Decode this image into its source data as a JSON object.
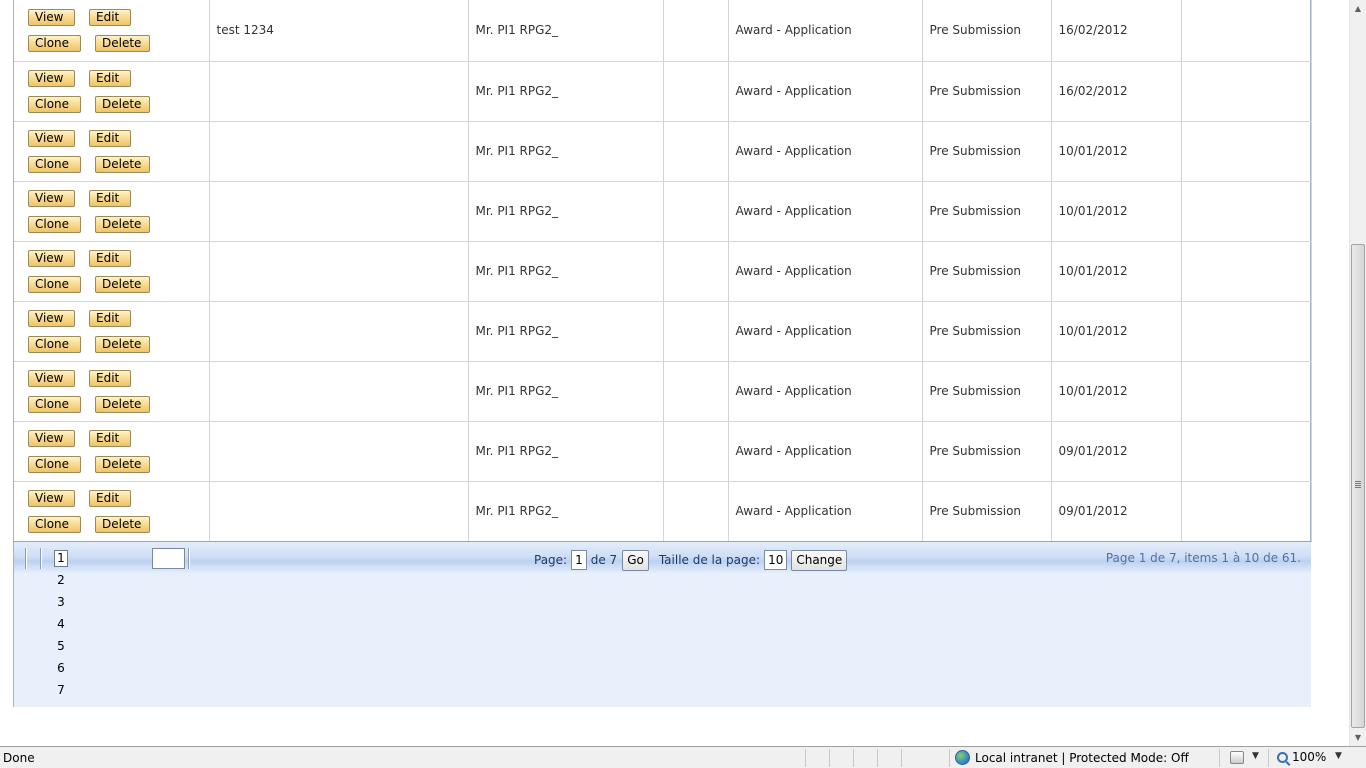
{
  "buttons": {
    "view": "View",
    "edit": "Edit",
    "clone": "Clone",
    "delete": "Delete"
  },
  "rows": [
    {
      "title": "test 1234",
      "pi": "Mr. PI1 RPG2_",
      "col3": "",
      "type": "Award - Application",
      "status": "Pre Submission",
      "date": "16/02/2012",
      "col7": ""
    },
    {
      "title": "",
      "pi": "Mr. PI1 RPG2_",
      "col3": "",
      "type": "Award - Application",
      "status": "Pre Submission",
      "date": "16/02/2012",
      "col7": ""
    },
    {
      "title": "",
      "pi": "Mr. PI1 RPG2_",
      "col3": "",
      "type": "Award - Application",
      "status": "Pre Submission",
      "date": "10/01/2012",
      "col7": ""
    },
    {
      "title": "",
      "pi": "Mr. PI1 RPG2_",
      "col3": "",
      "type": "Award - Application",
      "status": "Pre Submission",
      "date": "10/01/2012",
      "col7": ""
    },
    {
      "title": "",
      "pi": "Mr. PI1 RPG2_",
      "col3": "",
      "type": "Award - Application",
      "status": "Pre Submission",
      "date": "10/01/2012",
      "col7": ""
    },
    {
      "title": "",
      "pi": "Mr. PI1 RPG2_",
      "col3": "",
      "type": "Award - Application",
      "status": "Pre Submission",
      "date": "10/01/2012",
      "col7": ""
    },
    {
      "title": "",
      "pi": "Mr. PI1 RPG2_",
      "col3": "",
      "type": "Award - Application",
      "status": "Pre Submission",
      "date": "10/01/2012",
      "col7": ""
    },
    {
      "title": "",
      "pi": "Mr. PI1 RPG2_",
      "col3": "",
      "type": "Award - Application",
      "status": "Pre Submission",
      "date": "09/01/2012",
      "col7": ""
    },
    {
      "title": "",
      "pi": "Mr. PI1 RPG2_",
      "col3": "",
      "type": "Award - Application",
      "status": "Pre Submission",
      "date": "09/01/2012",
      "col7": ""
    }
  ],
  "pager": {
    "pages": [
      "1",
      "2",
      "3",
      "4",
      "5",
      "6",
      "7"
    ],
    "current_page": "1",
    "goto_value": "",
    "page_label": "Page:",
    "page_value": "1",
    "of_label": "de 7",
    "go_label": "Go",
    "size_label": "Taille de la page:",
    "size_value": "10",
    "change_label": "Change",
    "info": "Page 1 de 7, items 1 à 10 de 61."
  },
  "statusbar": {
    "status": "Done",
    "zone": "Local intranet | Protected Mode: Off",
    "zoom": "100%"
  },
  "icons": {
    "zone": "globe-icon",
    "security": "lock-icon",
    "zoom": "magnifier-icon"
  }
}
